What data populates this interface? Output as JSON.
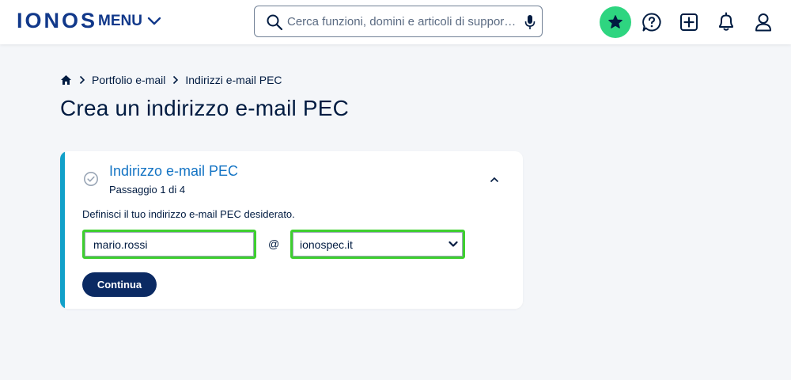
{
  "header": {
    "logo": "IONOS",
    "menu_label": "MENU",
    "search": {
      "placeholder": "Cerca funzioni, domini e articoli di suppor…",
      "value": ""
    },
    "icons": [
      "star-icon",
      "help-chat-icon",
      "add-icon",
      "bell-icon",
      "user-icon"
    ]
  },
  "breadcrumb": {
    "items": [
      "Portfolio e-mail",
      "Indirizzi e-mail PEC"
    ]
  },
  "page": {
    "title": "Crea un indirizzo e-mail PEC"
  },
  "step": {
    "title": "Indirizzo e-mail PEC",
    "subtitle": "Passaggio 1 di 4",
    "description": "Definisci il tuo indirizzo e-mail PEC desiderato.",
    "local_part_value": "mario.rossi",
    "at_symbol": "@",
    "domain_selected": "ionospec.it",
    "continue_label": "Continua"
  },
  "colors": {
    "brand": "#11388a",
    "accent": "#11a0c9",
    "highlight": "#3ecf2f",
    "button": "#0b2a63",
    "star_bg": "#2ed580"
  }
}
